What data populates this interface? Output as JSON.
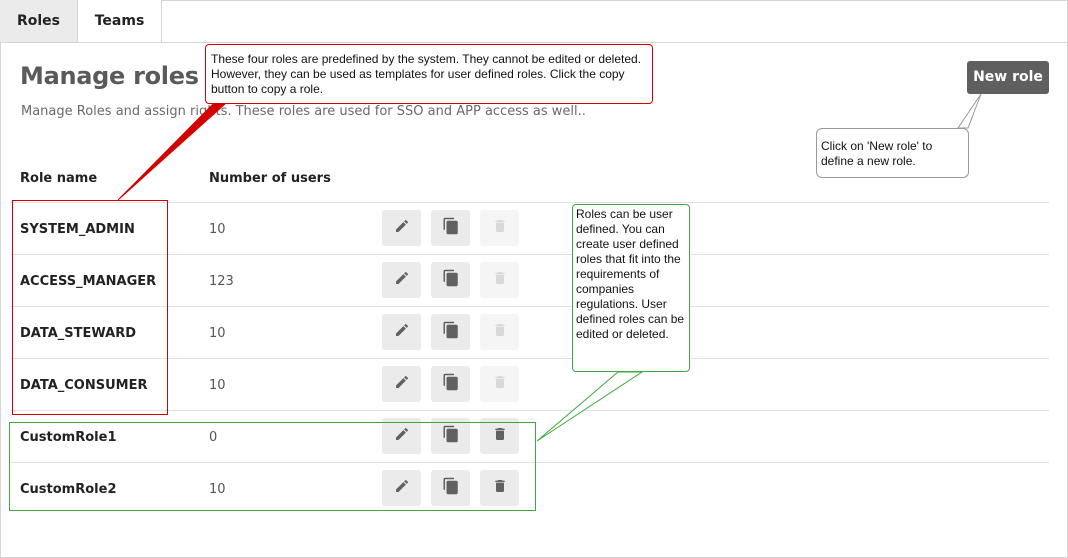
{
  "tabs": [
    {
      "label": "Roles",
      "active": true
    },
    {
      "label": "Teams",
      "active": false
    }
  ],
  "header": {
    "title": "Manage roles",
    "subtitle": "Manage Roles and assign rights. These roles are used for SSO and APP access as well..",
    "new_role_label": "New role"
  },
  "table": {
    "columns": [
      "Role name",
      "Number of users"
    ],
    "rows": [
      {
        "name": "SYSTEM_ADMIN",
        "users": "10",
        "delete_enabled": false
      },
      {
        "name": "ACCESS_MANAGER",
        "users": "123",
        "delete_enabled": false
      },
      {
        "name": "DATA_STEWARD",
        "users": "10",
        "delete_enabled": false
      },
      {
        "name": "DATA_CONSUMER",
        "users": "10",
        "delete_enabled": false
      },
      {
        "name": "CustomRole1",
        "users": "0",
        "delete_enabled": true
      },
      {
        "name": "CustomRole2",
        "users": "10",
        "delete_enabled": true
      }
    ]
  },
  "annotations": {
    "predefined": "These four roles are predefined by the system. They cannot be edited or deleted. However, they can be used as templates for user defined roles. Click the copy button to copy a role.",
    "new_role": "Click on 'New role' to define a new role.",
    "user_defined": "Roles can be user defined. You can create user defined roles that fit into the requirements of companies regulations. User defined roles can be edited or deleted."
  },
  "colors": {
    "annotation_red": "#d40000",
    "annotation_green": "#3ea83e",
    "annotation_grey": "#9a9a9a",
    "button_dark": "#5f5f5f",
    "action_bg": "#ebebeb",
    "icon": "#616161"
  },
  "icons": {
    "edit": "pencil-icon",
    "copy": "copy-icon",
    "delete": "trash-icon"
  }
}
